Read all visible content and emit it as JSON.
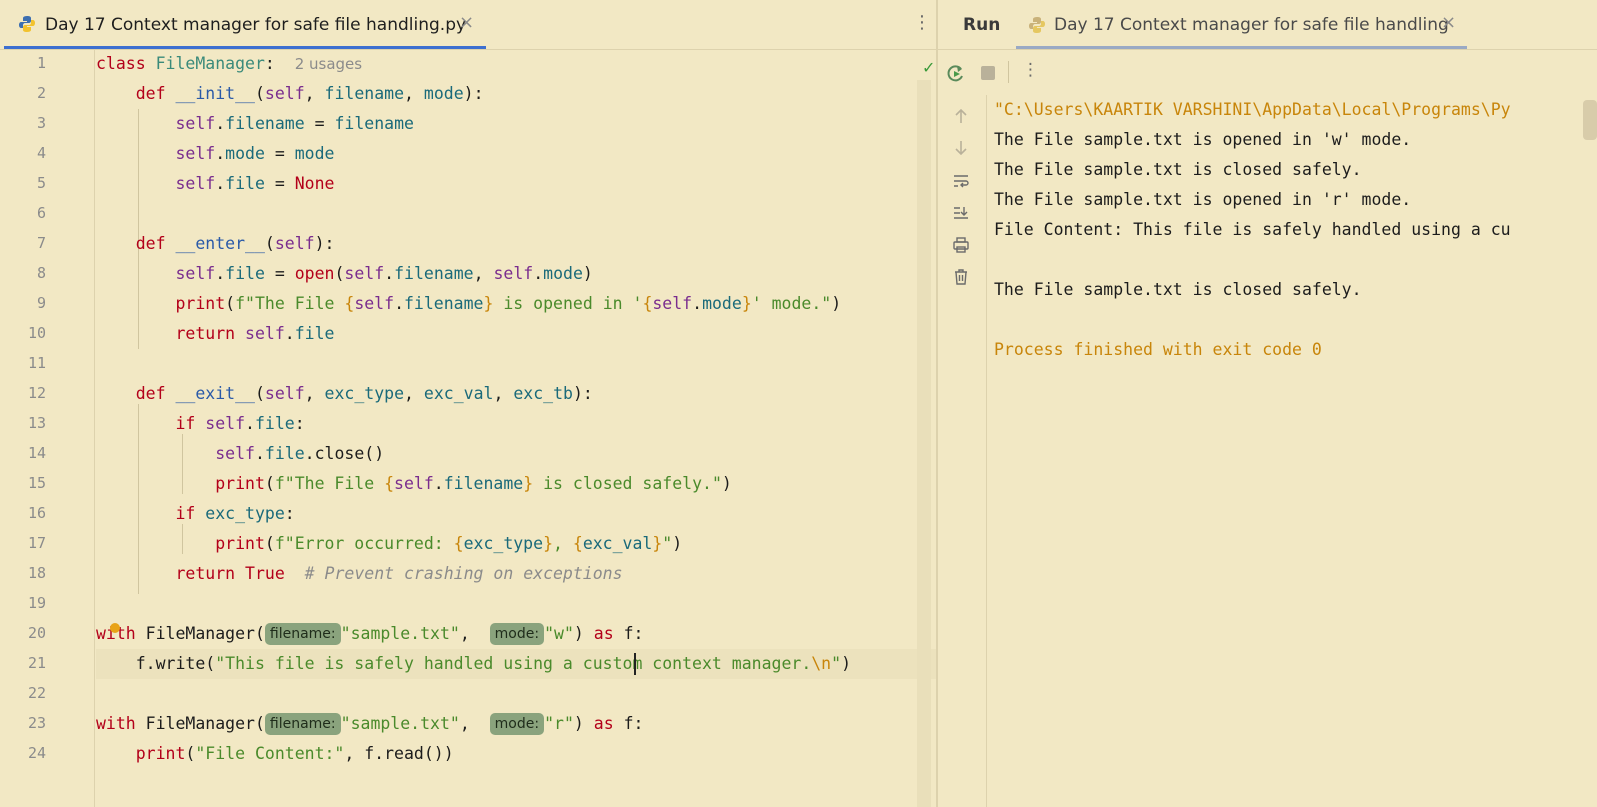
{
  "editor": {
    "tab_label": "Day 17 Context manager for safe file handling.py",
    "tab_close": "×",
    "menu": "⋮",
    "check": "✓",
    "usages": "2 usages",
    "line_numbers": [
      "1",
      "2",
      "3",
      "4",
      "5",
      "6",
      "7",
      "8",
      "9",
      "10",
      "11",
      "12",
      "13",
      "14",
      "15",
      "16",
      "17",
      "18",
      "19",
      "20",
      "21",
      "22",
      "23",
      "24"
    ],
    "hints": {
      "filename": "filename:",
      "mode": "mode:"
    }
  },
  "run": {
    "title": "Run",
    "tab_label": "Day 17 Context manager for safe file handling",
    "tab_close": "×",
    "menu": "⋮",
    "console_lines": [
      "\"C:\\Users\\KAARTIK VARSHINI\\AppData\\Local\\Programs\\Py",
      "The File sample.txt is opened in 'w' mode.",
      "The File sample.txt is closed safely.",
      "The File sample.txt is opened in 'r' mode.",
      "File Content: This file is safely handled using a cu",
      "",
      "The File sample.txt is closed safely.",
      "",
      "Process finished with exit code 0"
    ]
  },
  "colors": {
    "background": "#f2e8c4",
    "tab_underline": "#3d6fd0",
    "hint_bg": "#8aa37d"
  }
}
